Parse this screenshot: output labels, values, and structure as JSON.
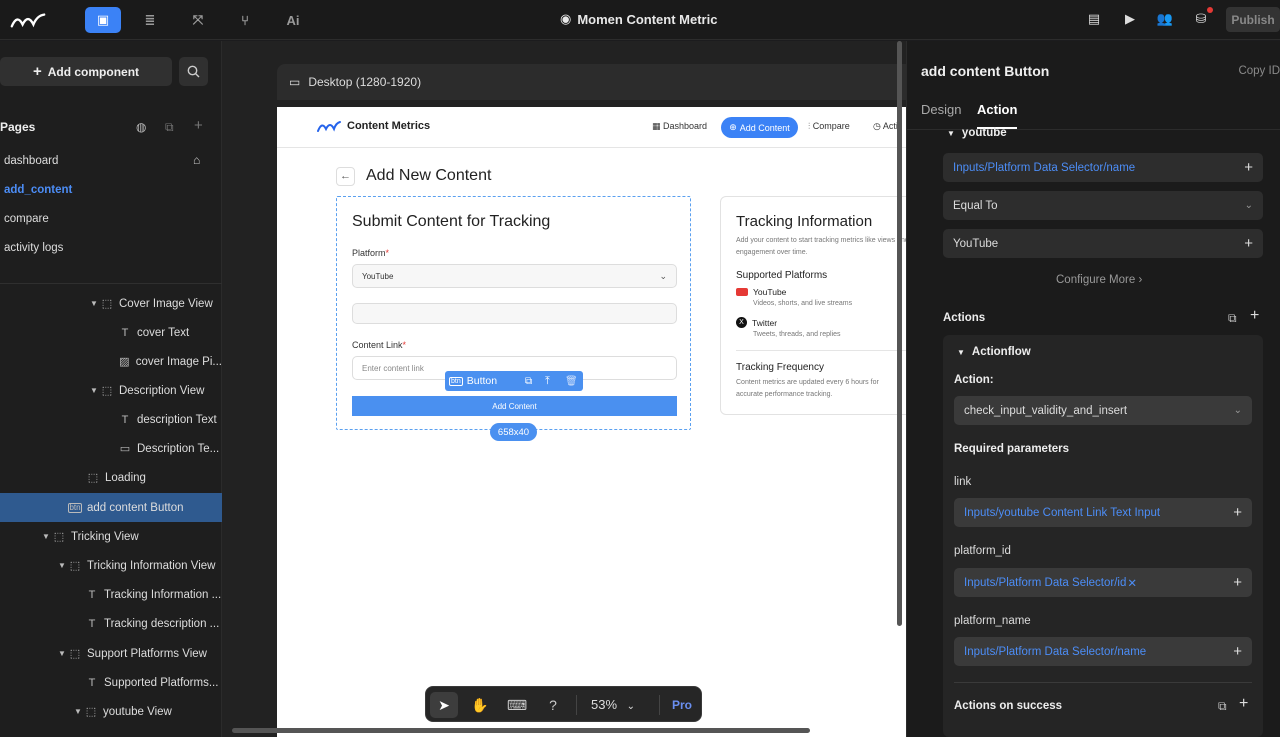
{
  "app": {
    "title": "Momen Content Metric",
    "publish_label": "Publish"
  },
  "left": {
    "add_component_label": "Add component",
    "pages_heading": "Pages",
    "pages": [
      "dashboard",
      "add_content",
      "compare",
      "activity logs"
    ],
    "tree": [
      {
        "label": "Cover Image View",
        "caret": true,
        "icon": "container-icon"
      },
      {
        "label": "cover Text",
        "caret": false,
        "icon": "text-icon"
      },
      {
        "label": "cover Image Pi...",
        "caret": false,
        "icon": "image-icon"
      },
      {
        "label": "Description View",
        "caret": true,
        "icon": "container-icon"
      },
      {
        "label": "description Text",
        "caret": false,
        "icon": "text-icon"
      },
      {
        "label": "Description Te...",
        "caret": false,
        "icon": "text-input-icon"
      },
      {
        "label": "Loading",
        "caret": false,
        "icon": "container-icon"
      },
      {
        "label": "add content Button",
        "caret": false,
        "icon": "button-icon",
        "selected": true
      },
      {
        "label": "Tricking View",
        "caret": true,
        "icon": "container-icon"
      },
      {
        "label": "Tricking Information View",
        "caret": true,
        "icon": "container-icon"
      },
      {
        "label": "Tracking Information ...",
        "caret": false,
        "icon": "text-icon"
      },
      {
        "label": "Tracking description ...",
        "caret": false,
        "icon": "text-icon"
      },
      {
        "label": "Support Platforms View",
        "caret": true,
        "icon": "container-icon"
      },
      {
        "label": "Supported Platforms...",
        "caret": false,
        "icon": "text-icon"
      },
      {
        "label": "youtube View",
        "caret": true,
        "icon": "container-icon"
      }
    ]
  },
  "canvas": {
    "device_label": "Desktop (1280-1920)",
    "zoom": "53%",
    "pro_label": "Pro",
    "inner": {
      "brand": "Content Metrics",
      "nav": {
        "dashboard": "Dashboard",
        "add": "Add Content",
        "compare": "Compare",
        "activity": "Acti"
      },
      "page_title": "Add New Content",
      "form": {
        "title": "Submit Content for Tracking",
        "platform_label": "Platform",
        "platform_value": "YouTube",
        "link_label": "Content Link",
        "link_placeholder": "Enter content link",
        "submit_label": "Add Content",
        "chip_label": "Button",
        "size_label": "658x40"
      },
      "info": {
        "title": "Tracking Information",
        "desc": "Add your content to start tracking metrics like views and engagement over time.",
        "platforms_heading": "Supported Platforms",
        "youtube": "YouTube",
        "youtube_desc": "Videos, shorts, and live streams",
        "twitter": "Twitter",
        "twitter_desc": "Tweets, threads, and replies",
        "freq_heading": "Tracking Frequency",
        "freq_desc": "Content metrics are updated every 6 hours for accurate performance tracking."
      }
    }
  },
  "right": {
    "title": "add content Button",
    "copy_id": "Copy ID",
    "tabs": {
      "design": "Design",
      "action": "Action"
    },
    "condition_group": "youtube",
    "cond_left": "Inputs/Platform Data Selector/name",
    "operator": "Equal To",
    "cond_right": "YouTube",
    "configure_more": "Configure More",
    "actions_label": "Actions",
    "actionflow_label": "Actionflow",
    "action_label": "Action:",
    "action_value": "check_input_validity_and_insert",
    "required_params": "Required parameters",
    "params": [
      {
        "name": "link",
        "value": "Inputs/youtube Content Link Text Input"
      },
      {
        "name": "platform_id",
        "value": "Inputs/Platform Data Selector/id"
      },
      {
        "name": "platform_name",
        "value": "Inputs/Platform Data Selector/name"
      }
    ],
    "on_success": "Actions on success"
  },
  "colors": {
    "accent": "#3b82f6",
    "selected_row": "#2f5a8f",
    "link_blue": "#4c8df6"
  }
}
